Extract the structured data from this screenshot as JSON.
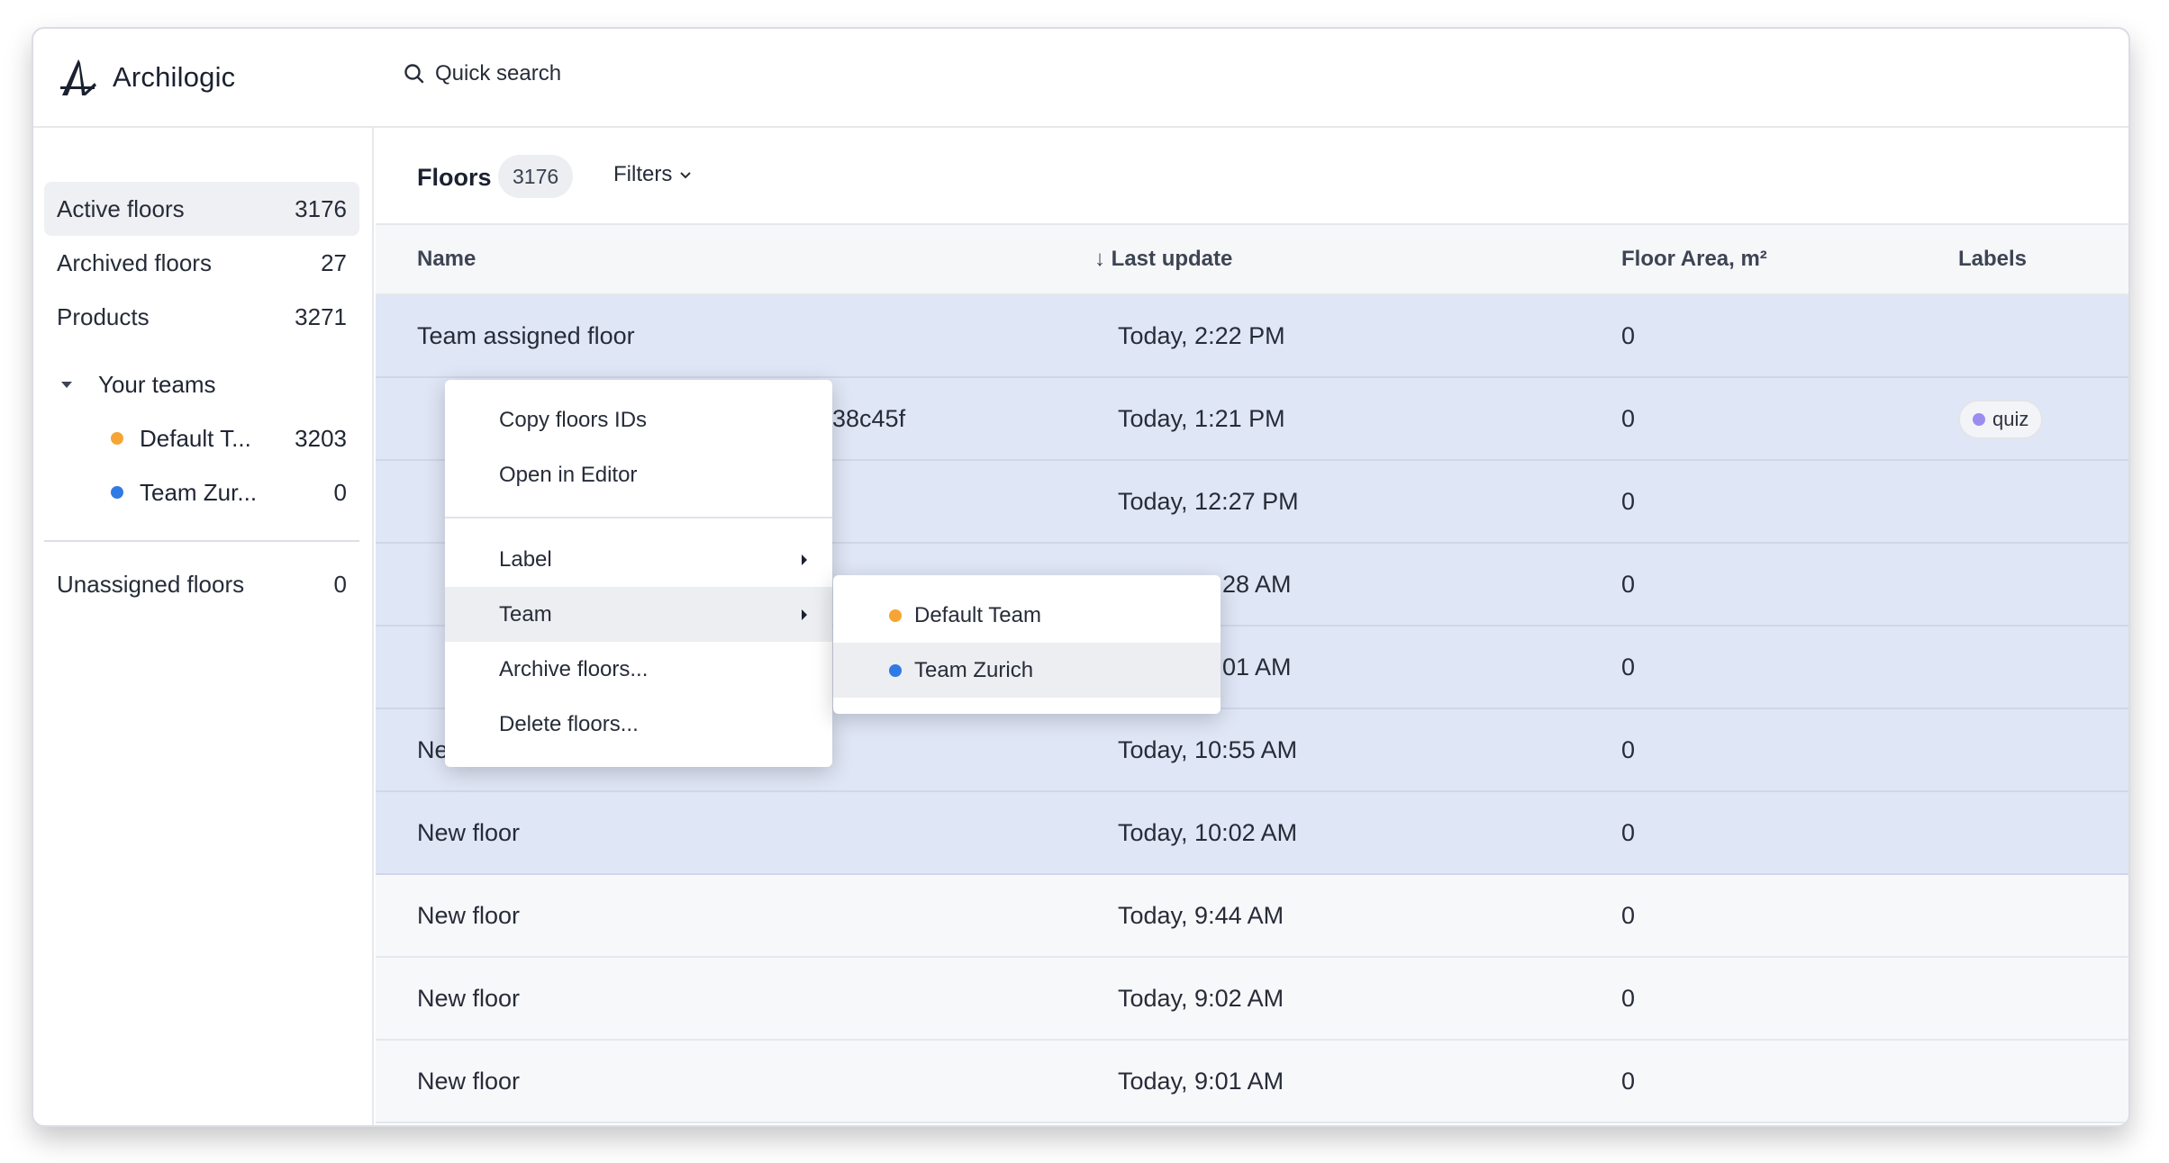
{
  "app": {
    "name": "Archilogic"
  },
  "search": {
    "placeholder": "Quick search"
  },
  "sidebar": {
    "items": [
      {
        "label": "Active floors",
        "count": "3176"
      },
      {
        "label": "Archived floors",
        "count": "27"
      },
      {
        "label": "Products",
        "count": "3271"
      }
    ],
    "teams_heading": "Your teams",
    "teams": [
      {
        "label": "Default T...",
        "count": "3203",
        "color": "#f4a534"
      },
      {
        "label": "Team Zur...",
        "count": "0",
        "color": "#2f7ae5"
      }
    ],
    "unassigned": {
      "label": "Unassigned floors",
      "count": "0"
    }
  },
  "main": {
    "title": "Floors",
    "count": "3176",
    "filters_label": "Filters"
  },
  "table": {
    "columns": {
      "name": "Name",
      "sort_indicator": "↓",
      "last_update": "Last update",
      "floor_area": "Floor Area, m²",
      "labels": "Labels"
    },
    "rows": [
      {
        "name": "Team assigned floor",
        "last_update": "Today, 2:22 PM",
        "area": "0"
      },
      {
        "name": "38c45f",
        "last_update": "Today, 1:21 PM",
        "area": "0",
        "label": "quiz"
      },
      {
        "name": "",
        "last_update": "Today, 12:27 PM",
        "area": "0"
      },
      {
        "name": "",
        "last_update": "28 AM",
        "area": "0"
      },
      {
        "name": "",
        "last_update": "01 AM",
        "area": "0"
      },
      {
        "name": "New floor",
        "last_update": "Today, 10:55 AM",
        "area": "0"
      },
      {
        "name": "New floor",
        "last_update": "Today, 10:02 AM",
        "area": "0"
      },
      {
        "name": "New floor",
        "last_update": "Today, 9:44 AM",
        "area": "0"
      },
      {
        "name": "New floor",
        "last_update": "Today, 9:02 AM",
        "area": "0"
      },
      {
        "name": "New floor",
        "last_update": "Today, 9:01 AM",
        "area": "0"
      }
    ],
    "label_color": "#9b8cf2"
  },
  "context_menu": {
    "items": [
      {
        "label": "Copy floors IDs"
      },
      {
        "label": "Open in Editor"
      },
      {
        "label": "Label"
      },
      {
        "label": "Team"
      },
      {
        "label": "Archive floors..."
      },
      {
        "label": "Delete floors..."
      }
    ],
    "team_submenu": [
      {
        "label": "Default Team",
        "color": "#f4a534"
      },
      {
        "label": "Team Zurich",
        "color": "#2f7ae5"
      }
    ]
  }
}
